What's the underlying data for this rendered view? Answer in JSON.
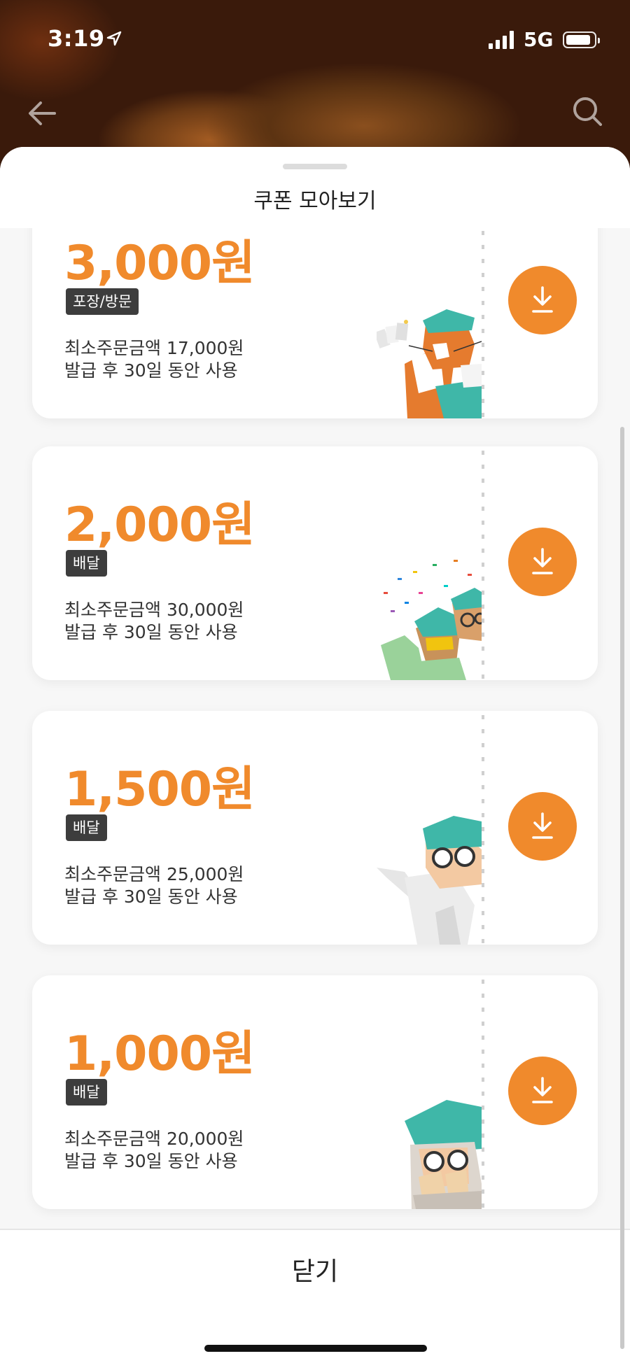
{
  "status": {
    "time": "3:19",
    "network": "5G"
  },
  "sheet": {
    "title": "쿠폰 모아보기",
    "close_label": "닫기"
  },
  "coupons": [
    {
      "amount": "3,000원",
      "tag": "포장/방문",
      "min_order": "최소주문금액 17,000원",
      "validity": "발급 후 30일 동안 사용",
      "art": "cat-with-coupons"
    },
    {
      "amount": "2,000원",
      "tag": "배달",
      "min_order": "최소주문금액 30,000원",
      "validity": "발급 후 30일 동안 사용",
      "art": "celebrating-characters"
    },
    {
      "amount": "1,500원",
      "tag": "배달",
      "min_order": "최소주문금액 25,000원",
      "validity": "발급 후 30일 동안 사용",
      "art": "pointing-character"
    },
    {
      "amount": "1,000원",
      "tag": "배달",
      "min_order": "최소주문금액 20,000원",
      "validity": "발급 후 30일 동안 사용",
      "art": "shy-character"
    }
  ],
  "icons": {
    "back": "back-arrow-icon",
    "search": "search-icon",
    "download": "download-icon",
    "location": "location-arrow-icon"
  },
  "colors": {
    "accent": "#f08a2c",
    "tag_bg": "#3d3d3d",
    "text": "#333333"
  }
}
